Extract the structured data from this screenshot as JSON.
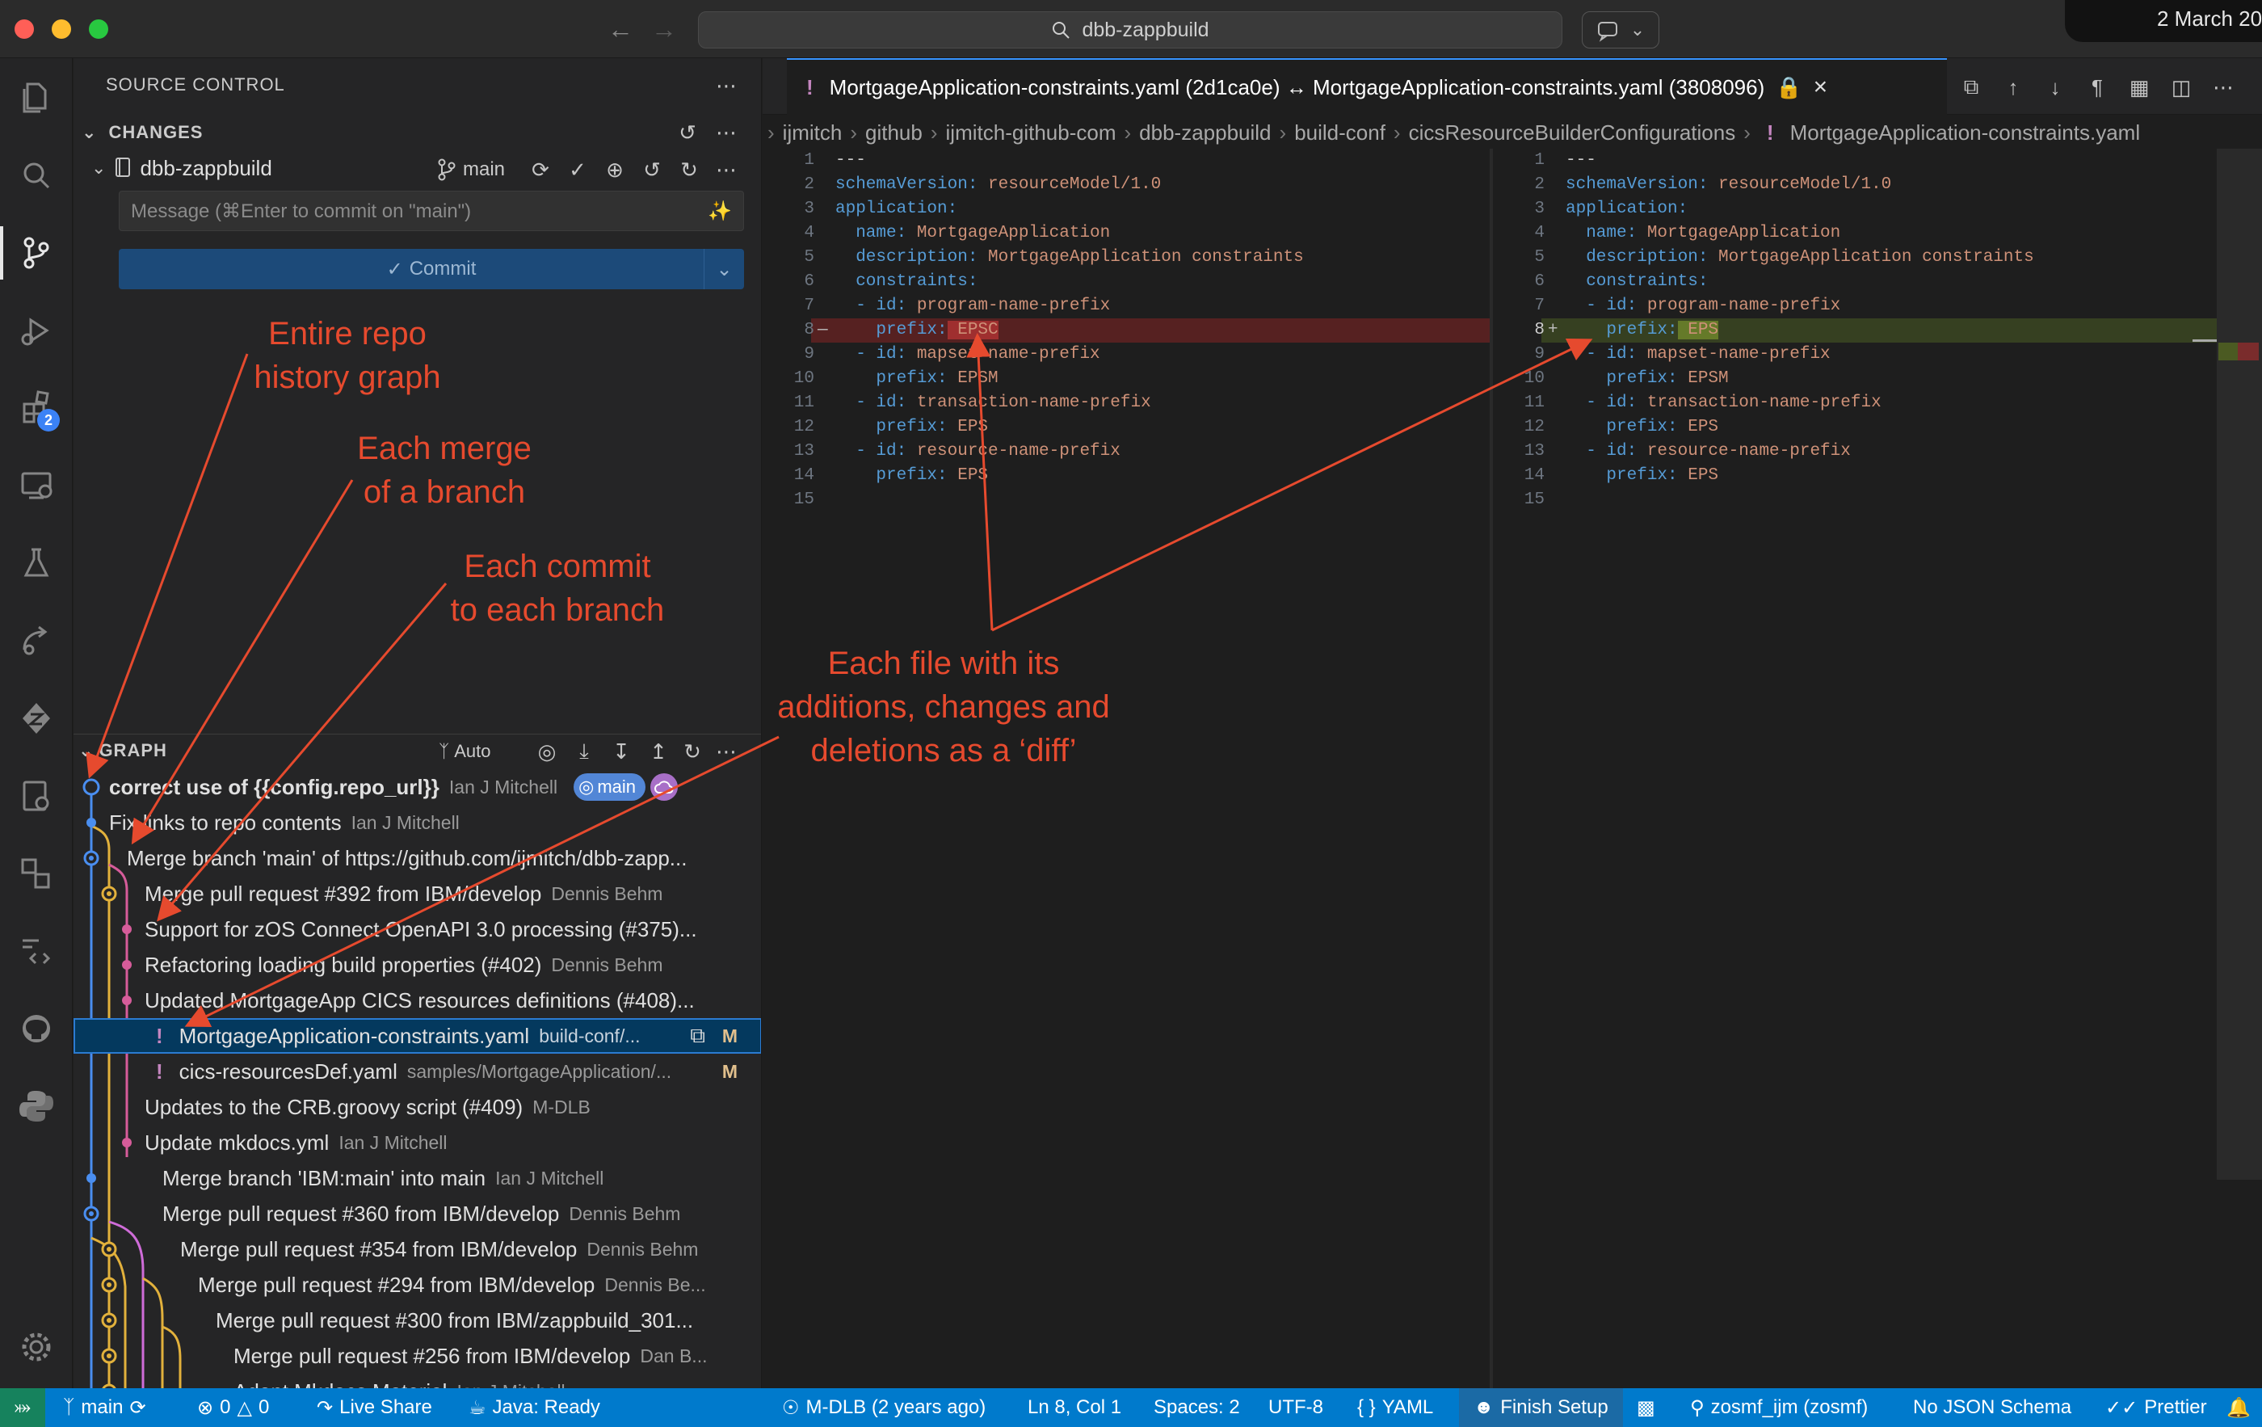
{
  "window": {
    "search_text": "dbb-zappbuild",
    "menu_date": "2 March 20"
  },
  "sidebar": {
    "title": "SOURCE CONTROL",
    "changes_header": "CHANGES",
    "repo_name": "dbb-zappbuild",
    "branch": "main",
    "message_placeholder": "Message (⌘Enter to commit on \"main\")",
    "commit_label": "Commit",
    "graph_header": "GRAPH",
    "graph_auto_label": "Auto"
  },
  "graph": {
    "rows": [
      {
        "title": "correct use of {{config.repo_url}}",
        "author": "Ian J Mitchell"
      },
      {
        "title": "Fix links to repo contents",
        "author": "Ian J Mitchell"
      },
      {
        "title": "Merge branch 'main' of https://github.com/ijmitch/dbb-zapp...",
        "author": ""
      },
      {
        "title": "Merge pull request #392 from IBM/develop",
        "author": "Dennis Behm"
      },
      {
        "title": "Support for zOS Connect OpenAPI 3.0 processing (#375)...",
        "author": ""
      },
      {
        "title": "Refactoring loading build properties (#402)",
        "author": "Dennis Behm"
      },
      {
        "title": "Updated MortgageApp CICS resources definitions (#408)...",
        "author": ""
      },
      {
        "title": "MortgageApplication-constraints.yaml",
        "author": "build-conf/..."
      },
      {
        "title": "cics-resourcesDef.yaml",
        "author": "samples/MortgageApplication/..."
      },
      {
        "title": "Updates to the CRB.groovy script (#409)",
        "author": "M-DLB"
      },
      {
        "title": "Update mkdocs.yml",
        "author": "Ian J Mitchell"
      },
      {
        "title": "Merge branch 'IBM:main' into main",
        "author": "Ian J Mitchell"
      },
      {
        "title": "Merge pull request #360 from IBM/develop",
        "author": "Dennis Behm"
      },
      {
        "title": "Merge pull request #354 from IBM/develop",
        "author": "Dennis Behm"
      },
      {
        "title": "Merge pull request #294 from IBM/develop",
        "author": "Dennis Be..."
      },
      {
        "title": "Merge pull request #300 from IBM/zappbuild_301...",
        "author": ""
      },
      {
        "title": "Merge pull request #256 from IBM/develop",
        "author": "Dan B..."
      },
      {
        "title": "Adopt Mkdocs Material",
        "author": "Ian J Mitchell"
      }
    ],
    "head_badge": "main",
    "file_status": "M"
  },
  "editor": {
    "tab_title": "MortgageApplication-constraints.yaml (2d1ca0e) ↔ MortgageApplication-constraints.yaml (3808096)",
    "tab_modifier": "!",
    "breadcrumb": [
      "ijmitch",
      "github",
      "ijmitch-github-com",
      "dbb-zappbuild",
      "build-conf",
      "cicsResourceBuilderConfigurations",
      "MortgageApplication-constraints.yaml"
    ],
    "line_numbers": [
      "1",
      "2",
      "3",
      "4",
      "5",
      "6",
      "7",
      "8",
      "9",
      "10",
      "11",
      "12",
      "13",
      "14",
      "15"
    ],
    "left_lines": [
      {
        "k": "---",
        "v": ""
      },
      {
        "k": "schemaVersion:",
        "v": " resourceModel/1.0"
      },
      {
        "k": "application:",
        "v": ""
      },
      {
        "k": "  name:",
        "v": " MortgageApplication"
      },
      {
        "k": "  description:",
        "v": " MortgageApplication constraints"
      },
      {
        "k": "  constraints:",
        "v": ""
      },
      {
        "k": "  - id:",
        "v": " program-name-prefix"
      },
      {
        "k": "    prefix:",
        "v": " EPSC"
      },
      {
        "k": "  - id:",
        "v": " mapset-name-prefix"
      },
      {
        "k": "    prefix:",
        "v": " EPSM"
      },
      {
        "k": "  - id:",
        "v": " transaction-name-prefix"
      },
      {
        "k": "    prefix:",
        "v": " EPS"
      },
      {
        "k": "  - id:",
        "v": " resource-name-prefix"
      },
      {
        "k": "    prefix:",
        "v": " EPS"
      },
      {
        "k": "",
        "v": ""
      }
    ],
    "right_lines": [
      {
        "k": "---",
        "v": ""
      },
      {
        "k": "schemaVersion:",
        "v": " resourceModel/1.0"
      },
      {
        "k": "application:",
        "v": ""
      },
      {
        "k": "  name:",
        "v": " MortgageApplication"
      },
      {
        "k": "  description:",
        "v": " MortgageApplication constraints"
      },
      {
        "k": "  constraints:",
        "v": ""
      },
      {
        "k": "  - id:",
        "v": " program-name-prefix"
      },
      {
        "k": "    prefix:",
        "v": " EPS"
      },
      {
        "k": "  - id:",
        "v": " mapset-name-prefix"
      },
      {
        "k": "    prefix:",
        "v": " EPSM"
      },
      {
        "k": "  - id:",
        "v": " transaction-name-prefix"
      },
      {
        "k": "    prefix:",
        "v": " EPS"
      },
      {
        "k": "  - id:",
        "v": " resource-name-prefix"
      },
      {
        "k": "    prefix:",
        "v": " EPS"
      },
      {
        "k": "",
        "v": ""
      }
    ],
    "deleted_marker": "—",
    "added_marker": "+"
  },
  "statusbar": {
    "branch": "main",
    "errors": "0",
    "warnings": "0",
    "live_share": "Live Share",
    "java": "Java: Ready",
    "blame": "M-DLB (2 years ago)",
    "cursor": "Ln 8, Col 1",
    "spaces": "Spaces: 2",
    "encoding": "UTF-8",
    "language": "YAML",
    "finish_setup": "Finish Setup",
    "zosmf": "zosmf_ijm (zosmf)",
    "schema": "No JSON Schema",
    "prettier": "Prettier"
  },
  "annotations": {
    "history": [
      "Entire repo",
      "history graph"
    ],
    "merge": [
      "Each merge",
      "of a branch"
    ],
    "commit": [
      "Each commit",
      "to each branch"
    ],
    "diff": [
      "Each file with its",
      "additions, changes and",
      "deletions as a ‘diff’"
    ]
  },
  "colors": {
    "accent": "#007acc",
    "annotation": "#e64a2e",
    "selection": "#04395e"
  }
}
